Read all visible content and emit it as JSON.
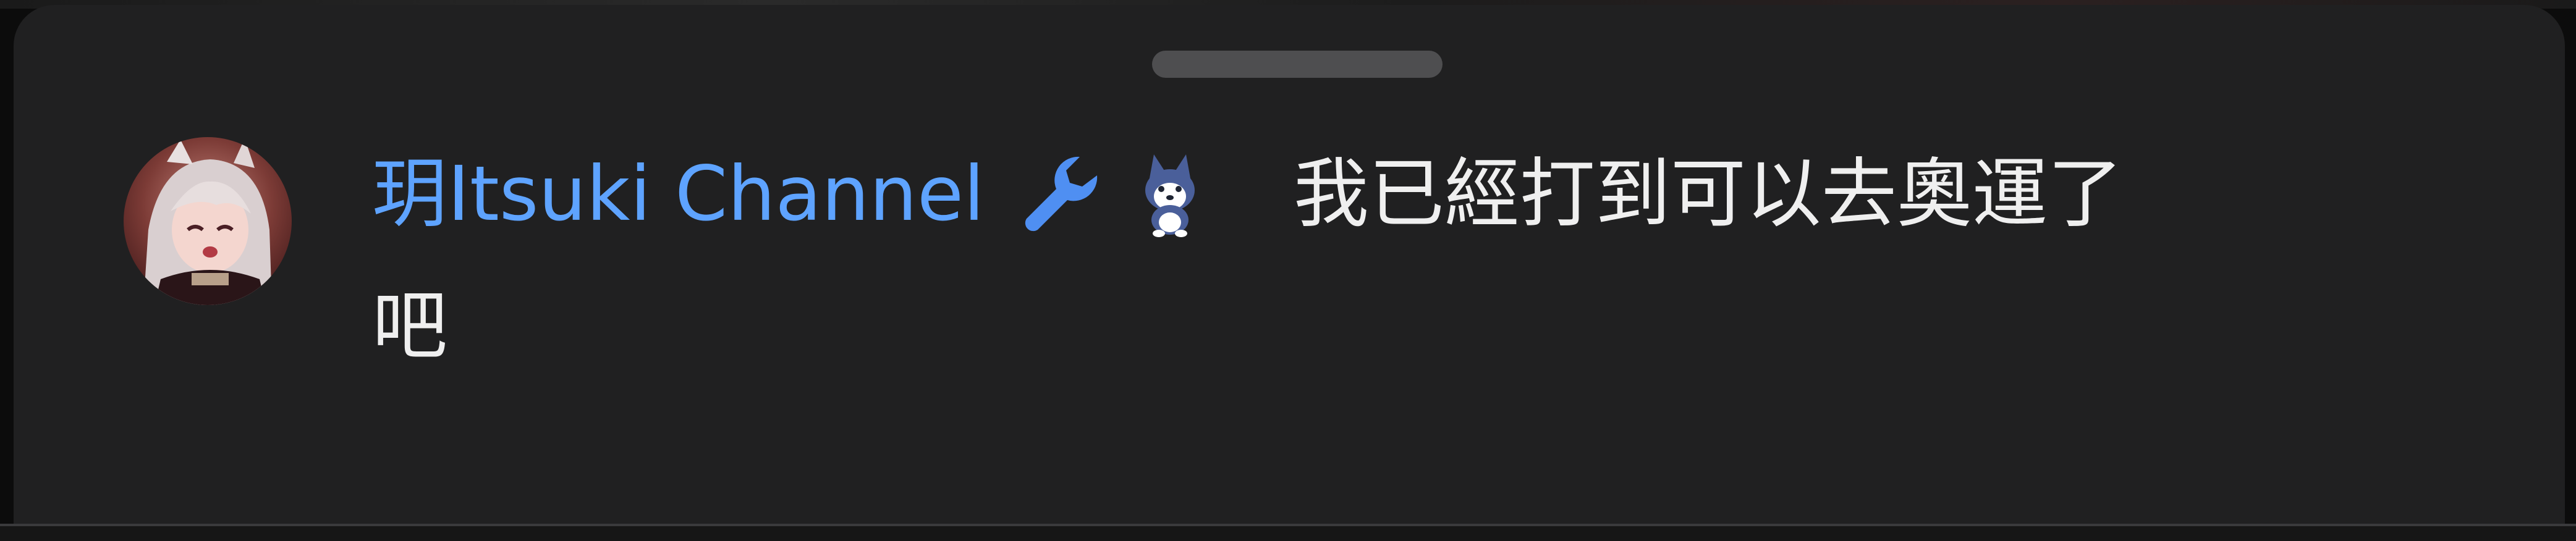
{
  "comment": {
    "author": "玥Itsuki Channel",
    "badges": [
      "wrench-icon",
      "husky-sticker-icon"
    ],
    "message_line1": "我已經打到可以去奧運了",
    "message_line2": "吧"
  },
  "colors": {
    "sheet_background": "#202021",
    "author_name": "#5ea3ff",
    "message_text": "#efefef",
    "wrench": "#4f8ff2",
    "drag_handle": "#4e4e50"
  }
}
